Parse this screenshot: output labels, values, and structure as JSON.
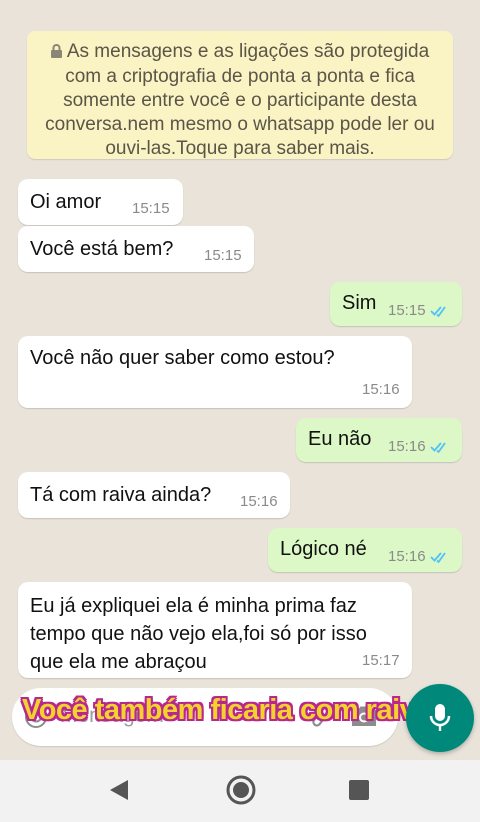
{
  "encryption_notice": {
    "lines": [
      "As mensagens e as ligações são protegida",
      "com a criptografia de ponta a ponta e fica",
      "somente entre você e o participante desta",
      "conversa.nem mesmo o whatsapp pode ler ou",
      "ouvi-las.Toque para saber mais."
    ]
  },
  "messages": [
    {
      "direction": "in",
      "lines": [
        "Oi amor"
      ],
      "time": "15:15"
    },
    {
      "direction": "in",
      "lines": [
        "Você está bem?"
      ],
      "time": "15:15"
    },
    {
      "direction": "out",
      "lines": [
        "Sim"
      ],
      "time": "15:15",
      "status": "read"
    },
    {
      "direction": "in",
      "lines": [
        "Você não quer saber como estou?"
      ],
      "time": "15:16"
    },
    {
      "direction": "out",
      "lines": [
        "Eu não"
      ],
      "time": "15:16",
      "status": "read"
    },
    {
      "direction": "in",
      "lines": [
        "Tá com raiva ainda?"
      ],
      "time": "15:16"
    },
    {
      "direction": "out",
      "lines": [
        "Lógico né"
      ],
      "time": "15:16",
      "status": "read"
    },
    {
      "direction": "in",
      "lines": [
        "Eu já expliquei ela é minha prima faz",
        "tempo que não vejo ela,foi só por isso",
        "que ela me abraçou"
      ],
      "time": "15:17"
    }
  ],
  "input": {
    "placeholder": "Mensagem"
  },
  "overlay_caption": "Você também ficaria com raiva?",
  "colors": {
    "accent": "#00897B",
    "outgoing": "#DCF8C6",
    "incoming": "#FFFFFF",
    "read_tick": "#4FC3F7",
    "notice": "#FAF3C4"
  },
  "icons": [
    "lock-icon",
    "read-receipt-icon",
    "emoji-icon",
    "attach-icon",
    "camera-icon",
    "mic-icon",
    "nav-back-icon",
    "nav-home-icon",
    "nav-recents-icon"
  ]
}
